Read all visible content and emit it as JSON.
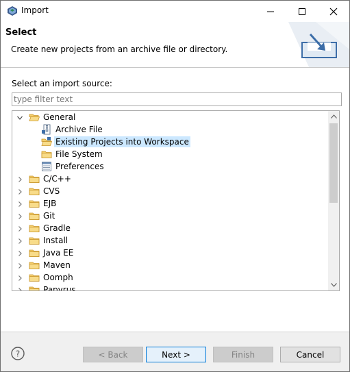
{
  "window": {
    "title": "Import",
    "minimize_icon": "minimize-icon",
    "maximize_icon": "maximize-icon",
    "close_icon": "close-icon"
  },
  "banner": {
    "title": "Select",
    "description": "Create new projects from an archive file or directory."
  },
  "main": {
    "source_label": "Select an import source:",
    "filter_placeholder": "type filter text",
    "filter_value": ""
  },
  "tree": {
    "items": [
      {
        "label": "General",
        "level": 0,
        "expanded": true,
        "icon": "folder-open-icon"
      },
      {
        "label": "Archive File",
        "level": 1,
        "icon": "archive-file-icon"
      },
      {
        "label": "Existing Projects into Workspace",
        "level": 1,
        "icon": "project-folder-icon",
        "selected": true
      },
      {
        "label": "File System",
        "level": 1,
        "icon": "folder-icon"
      },
      {
        "label": "Preferences",
        "level": 1,
        "icon": "preferences-icon"
      },
      {
        "label": "C/C++",
        "level": 0,
        "expanded": false,
        "icon": "folder-icon"
      },
      {
        "label": "CVS",
        "level": 0,
        "expanded": false,
        "icon": "folder-icon"
      },
      {
        "label": "EJB",
        "level": 0,
        "expanded": false,
        "icon": "folder-icon"
      },
      {
        "label": "Git",
        "level": 0,
        "expanded": false,
        "icon": "folder-icon"
      },
      {
        "label": "Gradle",
        "level": 0,
        "expanded": false,
        "icon": "folder-icon"
      },
      {
        "label": "Install",
        "level": 0,
        "expanded": false,
        "icon": "folder-icon"
      },
      {
        "label": "Java EE",
        "level": 0,
        "expanded": false,
        "icon": "folder-icon"
      },
      {
        "label": "Maven",
        "level": 0,
        "expanded": false,
        "icon": "folder-icon"
      },
      {
        "label": "Oomph",
        "level": 0,
        "expanded": false,
        "icon": "folder-icon"
      },
      {
        "label": "Papyrus",
        "level": 0,
        "expanded": false,
        "icon": "folder-icon"
      }
    ]
  },
  "footer": {
    "help_icon": "help-icon",
    "back_label": "< Back",
    "next_label": "Next >",
    "finish_label": "Finish",
    "cancel_label": "Cancel"
  },
  "colors": {
    "selection": "#cce8ff",
    "default_button_border": "#0078d7",
    "footer_bg": "#f0f0f0"
  }
}
